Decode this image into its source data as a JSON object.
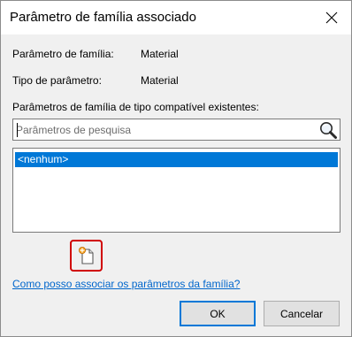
{
  "window": {
    "title": "Parâmetro de família associado",
    "close_icon": "close-icon"
  },
  "info": {
    "family_param_label": "Parâmetro de família:",
    "family_param_value": "Material",
    "param_type_label": "Tipo de parâmetro:",
    "param_type_value": "Material"
  },
  "existing": {
    "label": "Parâmetros de família de tipo compatível existentes:",
    "search_placeholder": "Parâmetros de pesquisa",
    "search_value": "",
    "search_icon": "magnifier-icon",
    "items": [
      {
        "label": "<nenhum>",
        "selected": true
      }
    ]
  },
  "new_parameter_button": {
    "icon": "new-parameter-icon",
    "highlight_color": "#d00000"
  },
  "help_link": "Como posso associar os parâmetros da família?",
  "buttons": {
    "ok": "OK",
    "cancel": "Cancelar"
  },
  "colors": {
    "selection": "#0078d7",
    "link": "#0066cc"
  }
}
